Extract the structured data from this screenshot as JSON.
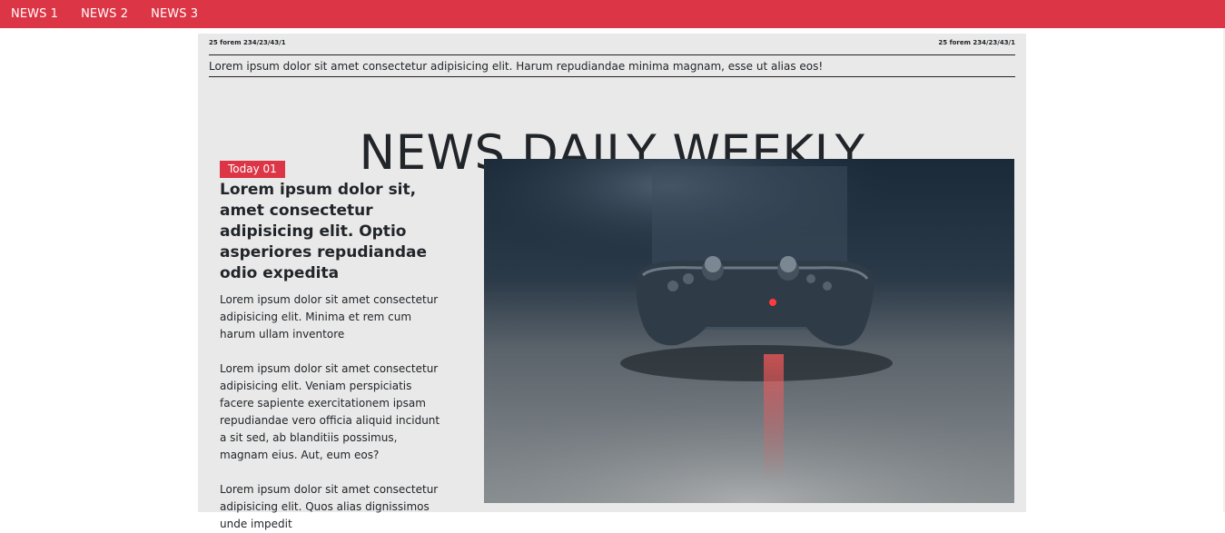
{
  "nav": {
    "items": [
      "NEWS 1",
      "NEWS 2",
      "NEWS 3"
    ]
  },
  "paper": {
    "meta_left": "25 forem 234/23/43/1",
    "meta_right": "25 forem 234/23/43/1",
    "tagline": "Lorem ipsum dolor sit amet consectetur adipisicing elit. Harum repudiandae minima magnam, esse ut alias eos!",
    "masthead": "NEWS DAILY WEEKLY"
  },
  "article": {
    "badge": "Today 01",
    "headline": "Lorem ipsum dolor sit, amet consectetur adipisicing elit. Optio asperiores repudiandae odio expedita",
    "paragraphs": [
      "Lorem ipsum dolor sit amet consectetur adipisicing elit. Minima et rem cum harum ullam inventore",
      "Lorem ipsum dolor sit amet consectetur adipisicing elit. Veniam perspiciatis facere sapiente exercitationem ipsam repudiandae vero officia aliquid incidunt a sit sed, ab blanditiis possimus, magnam eius. Aut, eum eos?",
      "Lorem ipsum dolor sit amet consectetur adipisicing elit. Quos alias dignissimos unde impedit"
    ],
    "image_icon": "gamepad-photo"
  },
  "colors": {
    "accent": "#dc3545",
    "paper_bg": "#e9e9e9",
    "text": "#212529"
  }
}
